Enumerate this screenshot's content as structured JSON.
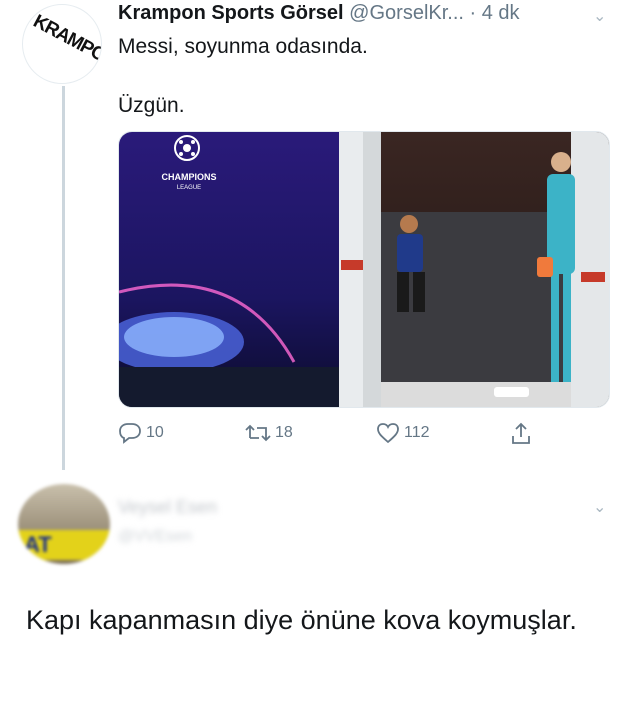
{
  "tweet": {
    "author_name": "Krampon Sports Görsel",
    "author_handle": "@GorselKr...",
    "time": "· 4 dk",
    "text_line1": "Messi, soyunma odasında.",
    "text_line2": "Üzgün.",
    "logo_text": "KRAMPON",
    "media": {
      "left_logo_text": "CHAMPIONS",
      "left_logo_subtext": "LEAGUE"
    },
    "actions": {
      "reply_count": "10",
      "retweet_count": "18",
      "like_count": "112"
    }
  },
  "reply": {
    "author_name": "Veysel Esen",
    "author_handle": "@VVEsen",
    "avatar_text": "AT",
    "text": "Kapı kapanmasın diye önüne kova koymuşlar."
  },
  "colors": {
    "text": "#14171a",
    "muted": "#657786",
    "thread_line": "#ccd6dd"
  },
  "icons": [
    "reply-icon",
    "retweet-icon",
    "like-icon",
    "share-icon",
    "chevron-down-icon"
  ]
}
